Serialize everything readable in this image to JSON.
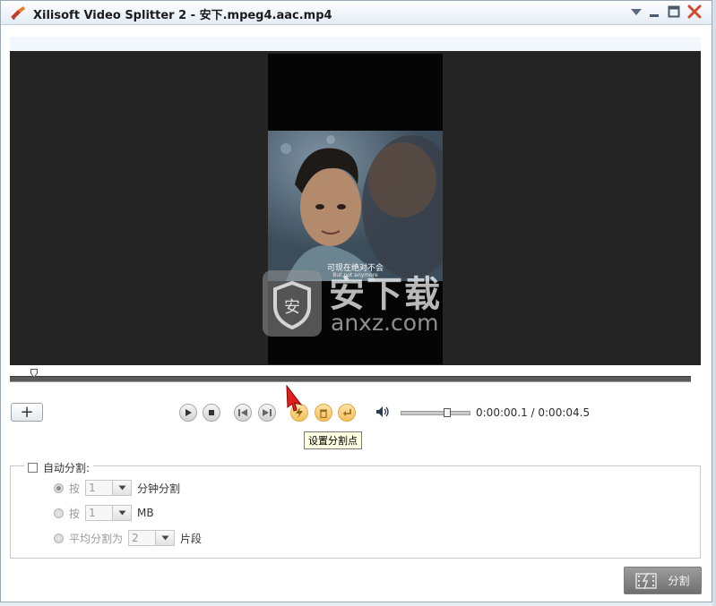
{
  "window": {
    "title": "Xilisoft Video Splitter 2 - 安下.mpeg4.aac.mp4"
  },
  "video": {
    "subtitle_cn": "可现在绝对不会",
    "subtitle_en": "But not anymore"
  },
  "watermark": {
    "text": "安下载",
    "url": "anxz.com"
  },
  "controls": {
    "add_label": "+",
    "time_display": "0:00:00.1 / 0:00:04.5",
    "volume_level": 0.65,
    "tooltip": "设置分割点"
  },
  "auto_split": {
    "label": "自动分割:",
    "checked": false,
    "options": [
      {
        "prefix": "按",
        "value": "1",
        "suffix": "分钟分割",
        "selected": true
      },
      {
        "prefix": "按",
        "value": "1",
        "suffix": "MB",
        "selected": false
      },
      {
        "prefix": "平均分割为",
        "value": "2",
        "suffix": "片段",
        "selected": false
      }
    ]
  },
  "split_button": {
    "label": "分割"
  },
  "colors": {
    "accent_orange": "#f3c05a",
    "video_bg": "#242424",
    "tooltip_bg": "#ffffe1"
  }
}
